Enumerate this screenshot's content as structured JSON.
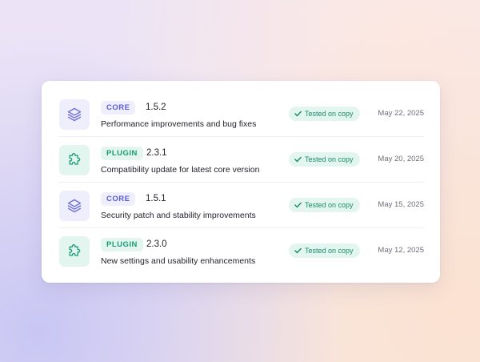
{
  "releases": [
    {
      "kind": "core",
      "icon": "layers-icon",
      "tag": "CORE",
      "version": "1.5.2",
      "description": "Performance improvements and bug fixes",
      "status": "Tested on copy",
      "date": "May 22, 2025"
    },
    {
      "kind": "plugin",
      "icon": "puzzle-icon",
      "tag": "PLUGIN",
      "version": "2.3.1",
      "description": "Compatibility update for latest core version",
      "status": "Tested on copy",
      "date": "May 20, 2025"
    },
    {
      "kind": "core",
      "icon": "layers-icon",
      "tag": "CORE",
      "version": "1.5.1",
      "description": "Security patch and stability improvements",
      "status": "Tested on copy",
      "date": "May 15, 2025"
    },
    {
      "kind": "plugin",
      "icon": "puzzle-icon",
      "tag": "PLUGIN",
      "version": "2.3.0",
      "description": "New settings and usability enhancements",
      "status": "Tested on copy",
      "date": "May 12, 2025"
    }
  ],
  "colors": {
    "core_accent": "#5b5bd6",
    "core_tint": "#eeeefc",
    "plugin_accent": "#1a9b76",
    "plugin_tint": "#e3f5ef",
    "status_check": "#1a8b6b"
  }
}
